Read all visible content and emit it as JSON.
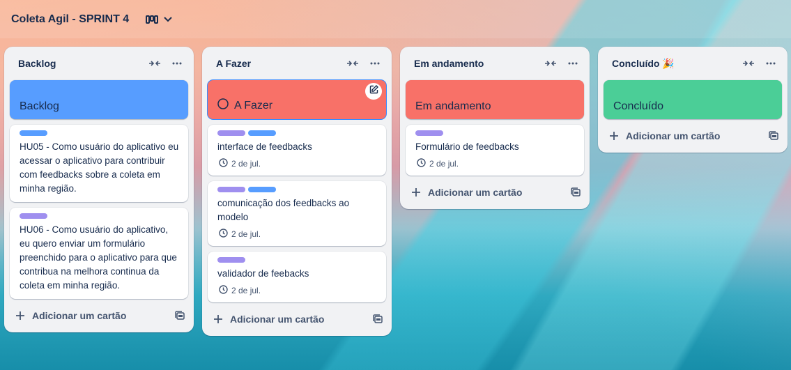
{
  "board": {
    "title": "Coleta Agil - SPRINT 4"
  },
  "colors": {
    "blue": "#579dff",
    "red": "#f87168",
    "green": "#4bce97",
    "purple": "#9f8fef"
  },
  "lists": [
    {
      "name": "Backlog",
      "cover": {
        "title": "Backlog",
        "color": "#579dff"
      },
      "cards": [
        {
          "title": "HU05 - Como usuário do aplicativo eu acessar o aplicativo para contribuir com feedbacks sobre a coleta em minha região.",
          "labels": [
            "blue"
          ]
        },
        {
          "title": "HU06 - Como usuário do aplicativo, eu quero enviar um formulário preenchido para o aplicativo para que contribua na melhora continua da coleta em minha região.",
          "labels": [
            "purple"
          ]
        }
      ],
      "add_label": "Adicionar um cartão"
    },
    {
      "name": "A Fazer",
      "cover": {
        "title": "A Fazer",
        "color": "#f87168"
      },
      "cards": [
        {
          "title": "interface de feedbacks",
          "labels": [
            "purple",
            "blue"
          ],
          "due": "2 de jul."
        },
        {
          "title": "comunicação dos feedbacks ao modelo",
          "labels": [
            "purple",
            "blue"
          ],
          "due": "2 de jul."
        },
        {
          "title": "validador de feebacks",
          "labels": [
            "purple"
          ],
          "due": "2 de jul."
        }
      ],
      "add_label": "Adicionar um cartão"
    },
    {
      "name": "Em andamento",
      "cover": {
        "title": "Em andamento",
        "color": "#f87168"
      },
      "cards": [
        {
          "title": "Formulário de feedbacks",
          "labels": [
            "purple"
          ],
          "due": "2 de jul."
        }
      ],
      "add_label": "Adicionar um cartão"
    },
    {
      "name": "Concluído 🎉",
      "cover": {
        "title": "Concluído",
        "color": "#4bce97"
      },
      "cards": [],
      "add_label": "Adicionar um cartão"
    }
  ]
}
